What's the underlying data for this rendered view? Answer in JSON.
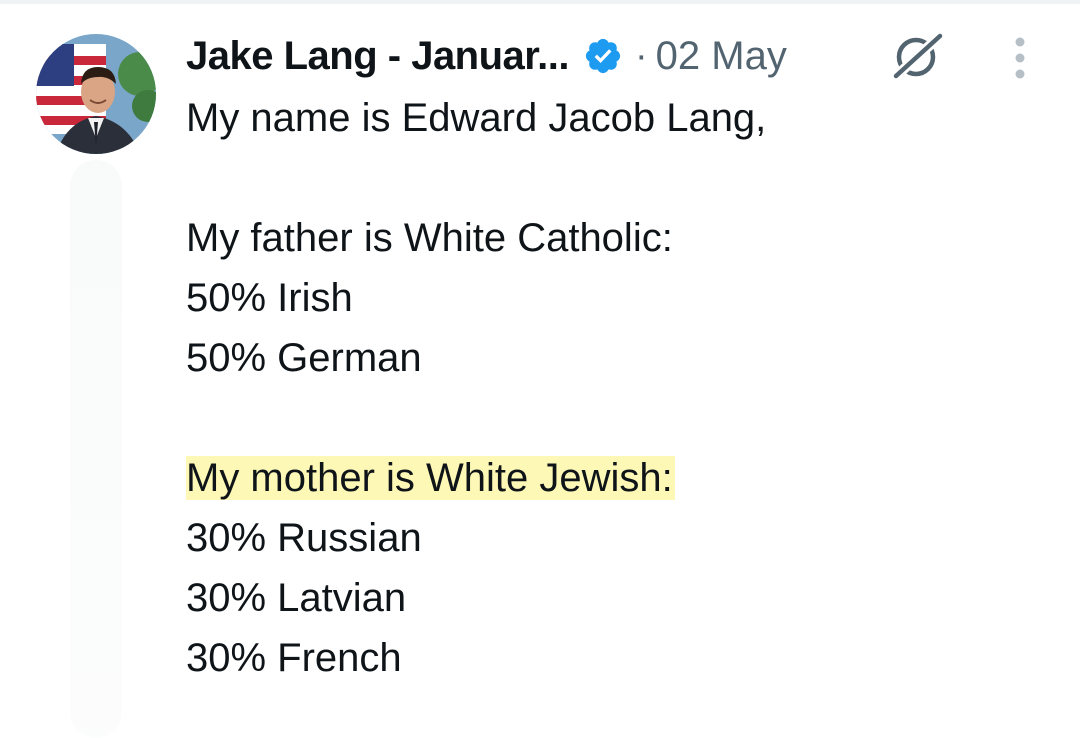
{
  "tweet": {
    "author": {
      "display_name": "Jake Lang - Januar...",
      "verified_icon": "verified-badge-icon",
      "avatar_icon": "avatar"
    },
    "separator": "·",
    "timestamp": "02 May",
    "actions": {
      "grok_icon": "grok-icon",
      "more_icon": "more-icon"
    },
    "body": {
      "line1": "My name is Edward Jacob Lang,",
      "line2": "My father is White Catholic:",
      "line3": "50% Irish",
      "line4": "50% German",
      "line5": "My mother is White Jewish:",
      "line6": "30% Russian",
      "line7": "30% Latvian",
      "line8": "30% French"
    },
    "colors": {
      "text": "#0f1419",
      "secondary": "#536471",
      "verified": "#1d9bf0",
      "highlight": "#fef8b6"
    }
  }
}
